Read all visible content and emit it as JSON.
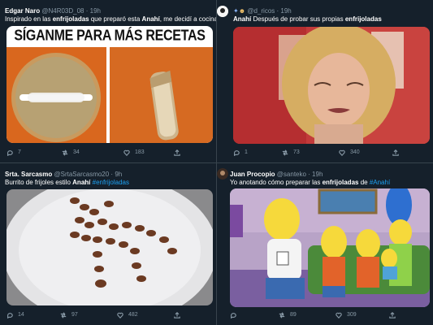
{
  "tweets": [
    {
      "name": "Edgar Naro",
      "handle": "@N4R03D_08 · 19h",
      "text_pre": "Inspirado en las ",
      "text_b1": "enfrijoladas",
      "text_mid": " que preparó esta ",
      "text_b2": "Anahí",
      "text_post": ", me decidí a cocinar...",
      "meme_caption": "SÍGANME PARA MÁS RECETAS",
      "replies": "7",
      "retweets": "34",
      "likes": "183"
    },
    {
      "name": "",
      "handle": "@d_ricos · 19h",
      "text_b1": "Anahí",
      "text_post": " Después de probar sus propias ",
      "text_b2": "enfrijoladas",
      "replies": "1",
      "retweets": "73",
      "likes": "340"
    },
    {
      "name": "Srta. Sarcasmo",
      "handle": "@SrtaSarcasmo20 · 9h",
      "text_pre": "Burrito de frijoles estilo ",
      "text_b1": "Anahí",
      "text_tag": " #enfrijoladas",
      "replies": "14",
      "retweets": "97",
      "likes": "482"
    },
    {
      "name": "Juan Procopio",
      "handle": "@santeko · 19h",
      "text_pre": "Yo anotando cómo preparar las ",
      "text_b1": "enfrijoladas",
      "text_mid": " de ",
      "text_tag": "#Anahí",
      "replies": "",
      "retweets": "89",
      "likes": "309"
    }
  ],
  "colors": {
    "background": "#15202b",
    "border": "#38444d",
    "muted": "#8899a6",
    "link": "#1da1f2"
  },
  "icons": [
    "reply-icon",
    "retweet-icon",
    "like-icon",
    "share-icon"
  ]
}
